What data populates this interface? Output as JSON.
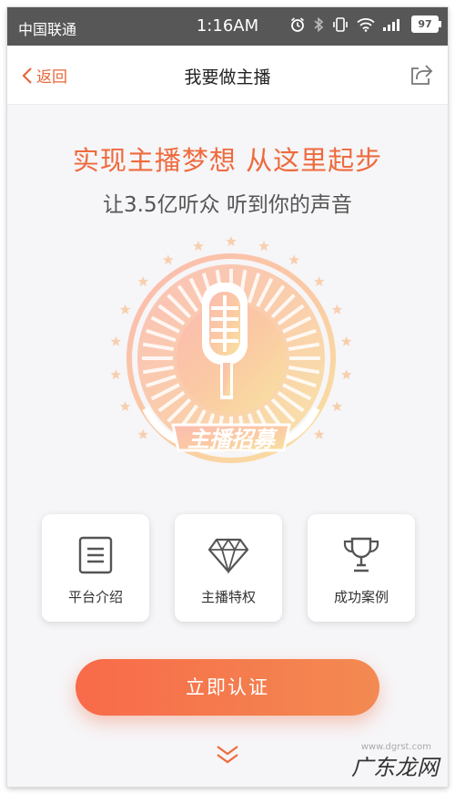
{
  "status_bar": {
    "carrier": "中国联通",
    "time": "1:16AM",
    "battery": "97"
  },
  "nav": {
    "back_label": "返回",
    "title": "我要做主播"
  },
  "hero": {
    "title": "实现主播梦想 从这里起步",
    "subtitle": "让3.5亿听众 听到你的声音"
  },
  "emblem": {
    "text": "主播招募"
  },
  "cards": [
    {
      "label": "平台介绍",
      "icon": "document-icon"
    },
    {
      "label": "主播特权",
      "icon": "diamond-icon"
    },
    {
      "label": "成功案例",
      "icon": "trophy-icon"
    }
  ],
  "cta": {
    "label": "立即认证"
  },
  "watermark": {
    "text": "广东龙网",
    "sub": "www.dgrst.com"
  },
  "colors": {
    "accent": "#ee6b3e",
    "cta_start": "#f96a4a",
    "cta_end": "#f38a52",
    "status_bar": "#575757"
  }
}
